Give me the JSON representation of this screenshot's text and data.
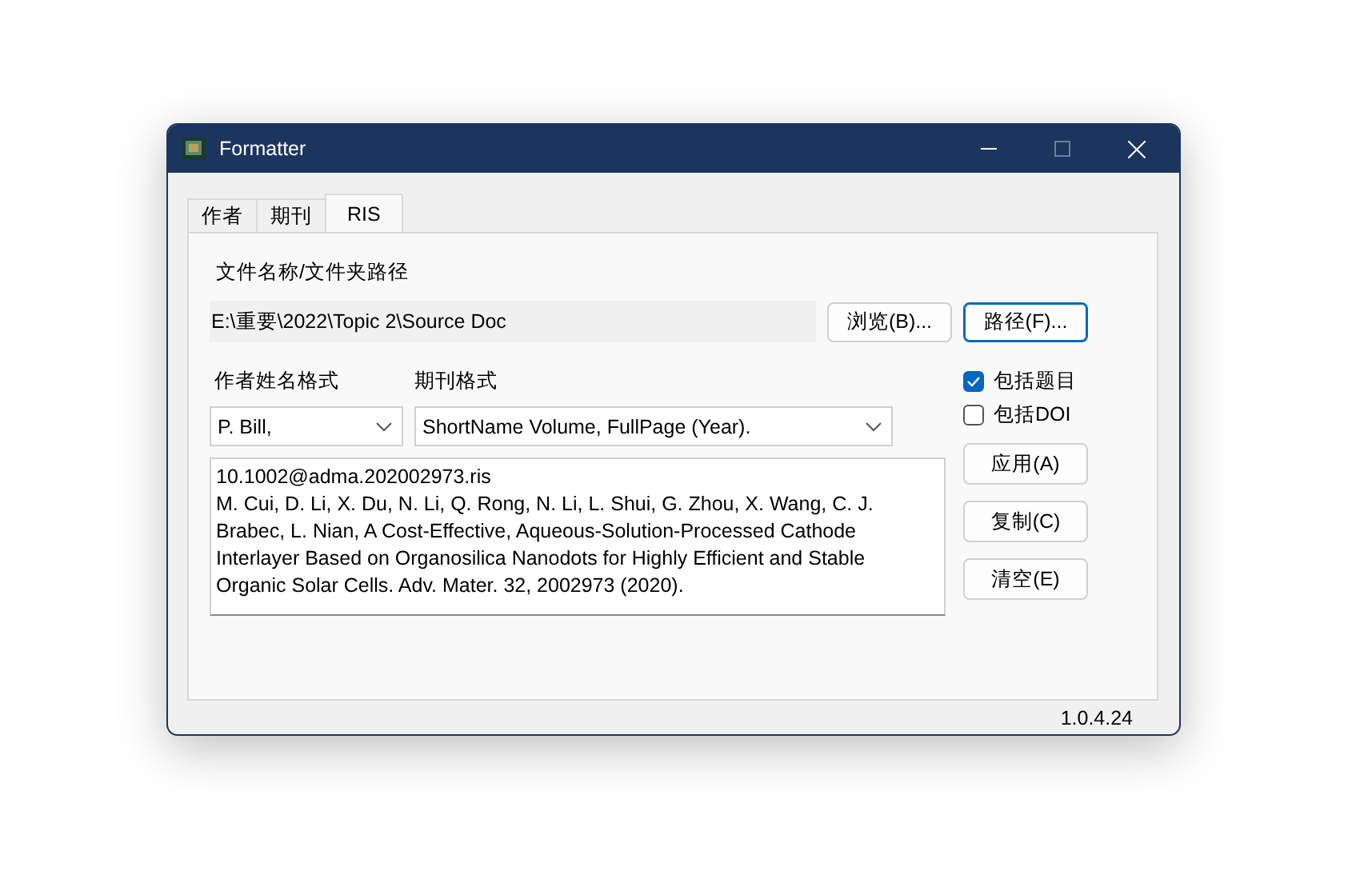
{
  "window": {
    "title": "Formatter"
  },
  "tabs": [
    {
      "label": "作者",
      "selected": false
    },
    {
      "label": "期刊",
      "selected": false
    },
    {
      "label": "RIS",
      "selected": true
    }
  ],
  "path": {
    "label": "文件名称/文件夹路径",
    "value": "E:\\重要\\2022\\Topic 2\\Source Doc",
    "buttons": [
      {
        "label": "浏览(B)...",
        "focused": false
      },
      {
        "label": "路径(F)...",
        "focused": true
      }
    ]
  },
  "author_format": {
    "label": "作者姓名格式",
    "value": "P. Bill,"
  },
  "journal_format": {
    "label": "期刊格式",
    "value": "ShortName Volume, FullPage (Year)."
  },
  "options": [
    {
      "label": "包括题目",
      "checked": true
    },
    {
      "label": "包括DOI",
      "checked": false
    }
  ],
  "output": {
    "lines": [
      "10.1002@adma.202002973.ris",
      "M. Cui, D. Li, X. Du, N. Li, Q. Rong, N. Li, L. Shui, G. Zhou, X. Wang, C. J.",
      "Brabec, L. Nian, A Cost-Effective, Aqueous-Solution-Processed Cathode",
      "Interlayer Based on Organosilica Nanodots for Highly Efficient and Stable",
      "Organic Solar Cells. Adv. Mater. 32, 2002973 (2020)."
    ]
  },
  "actions": [
    "应用(A)",
    "复制(C)",
    "清空(E)"
  ],
  "version": "1.0.4.24"
}
